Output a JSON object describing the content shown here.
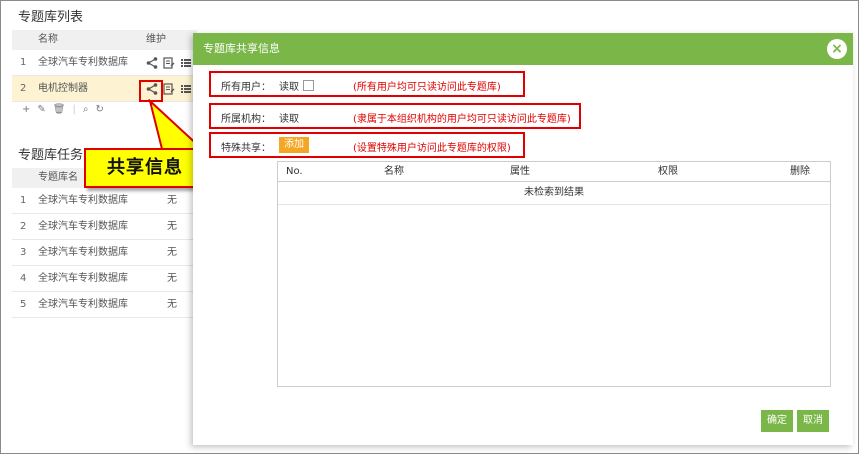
{
  "list_section": {
    "title": "专题库列表",
    "col_name": "名称",
    "col_maint": "维护",
    "rows": [
      {
        "num": "1",
        "name": "全球汽车专利数据库"
      },
      {
        "num": "2",
        "name": "电机控制器"
      }
    ]
  },
  "task_section": {
    "title": "专题库任务",
    "col_name": "专题库名",
    "rows": [
      {
        "num": "1",
        "name": "全球汽车专利数据库",
        "value": "无"
      },
      {
        "num": "2",
        "name": "全球汽车专利数据库",
        "value": "无"
      },
      {
        "num": "3",
        "name": "全球汽车专利数据库",
        "value": "无"
      },
      {
        "num": "4",
        "name": "全球汽车专利数据库",
        "value": "无"
      },
      {
        "num": "5",
        "name": "全球汽车专利数据库",
        "value": "无"
      }
    ]
  },
  "callout": {
    "text": "共享信息"
  },
  "modal": {
    "title": "专题库共享信息",
    "close_icon": "close-icon",
    "all_users": {
      "label": "所有用户：",
      "value": "读取",
      "hint": "(所有用户均可只读访问此专题库)"
    },
    "org": {
      "label": "所属机构：",
      "value": "读取",
      "hint": "(隶属于本组织机构的用户均可只读访问此专题库)"
    },
    "special": {
      "label": "特殊共享：",
      "button": "添加",
      "hint": "(设置特殊用户访问此专题库的权限)"
    },
    "table": {
      "headers": [
        "No.",
        "名称",
        "属性",
        "权限",
        "删除"
      ],
      "empty": "未检索到结果"
    },
    "ok": "确定",
    "cancel": "取消"
  },
  "colors": {
    "accent": "#7ab648",
    "highlight": "#e00000",
    "callout": "#ffff00",
    "add_button": "#f5a623"
  }
}
